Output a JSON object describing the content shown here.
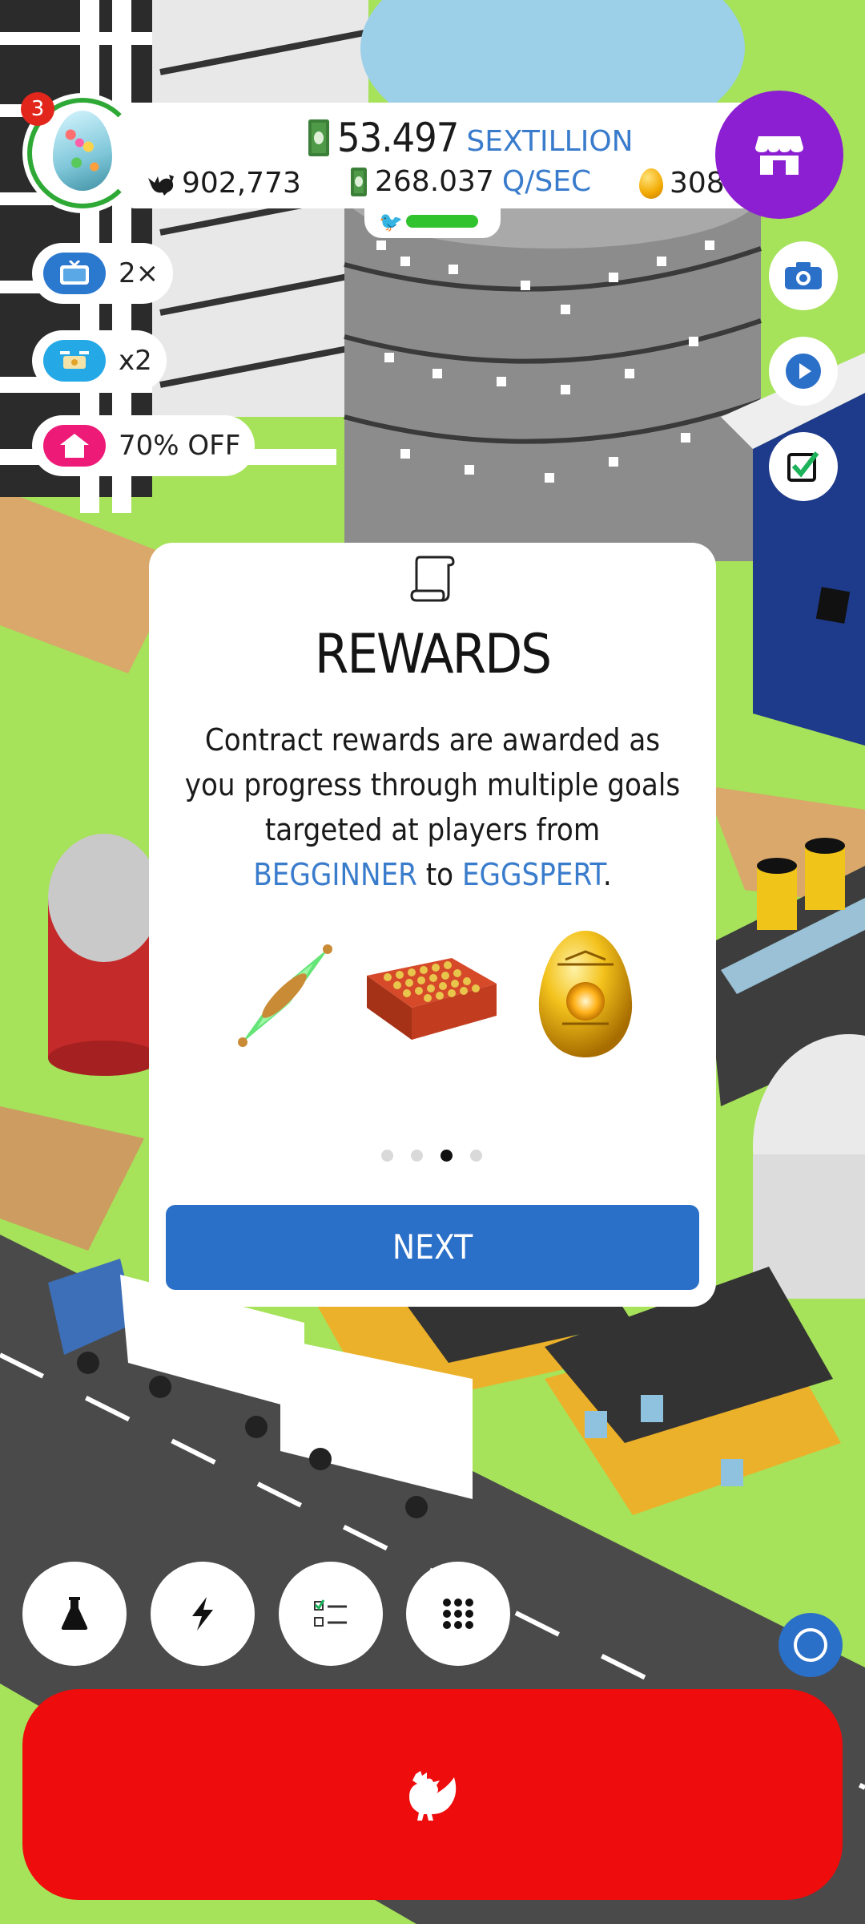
{
  "hud": {
    "badge_count": "3",
    "cash_value": "53.497",
    "cash_unit": "SEXTILLION",
    "chickens": "902,773",
    "rate_value": "268.037",
    "rate_unit": "Q/SEC",
    "golden_eggs": "308",
    "habitat_progress": 0.75
  },
  "boosts": [
    {
      "label": "2×",
      "icon": "tv-icon"
    },
    {
      "label": "x2",
      "icon": "drone-icon"
    },
    {
      "label": "70% OFF",
      "icon": "house-sale-icon"
    }
  ],
  "side_buttons": [
    "camera-icon",
    "play-icon",
    "checkbox-icon"
  ],
  "modal": {
    "title": "REWARDS",
    "body_pre": "Contract rewards are awarded as you progress through multiple goals targeted at players from ",
    "highlight_1": "BEGGINNER",
    "body_mid": " to ",
    "highlight_2": "EGGSPERT",
    "body_post": ".",
    "rewards": [
      "green-crystal-artifact",
      "egg-crate",
      "golden-egg"
    ],
    "page_current": 3,
    "page_total": 4,
    "next_label": "NEXT"
  },
  "toolbar": [
    "flask-icon",
    "lightning-icon",
    "checklist-icon",
    "grid-icon"
  ],
  "colors": {
    "accent_blue": "#2a6fc8",
    "shop_purple": "#8b1fd1",
    "hatch_red": "#ee0c0c",
    "progress_green": "#31c32e"
  }
}
